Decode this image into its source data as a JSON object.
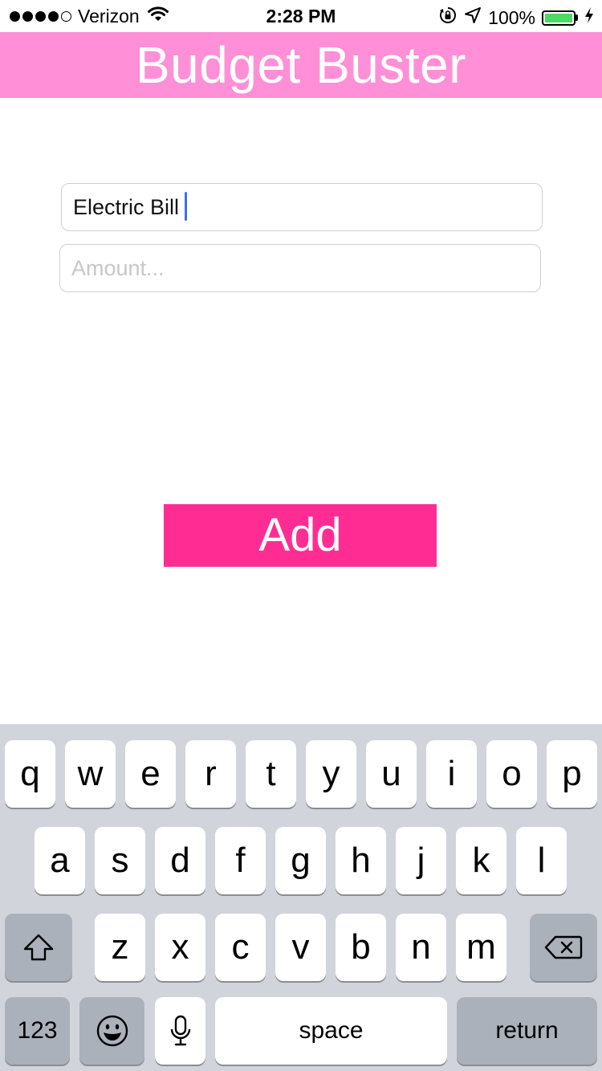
{
  "status_bar": {
    "carrier": "Verizon",
    "time": "2:28 PM",
    "battery": "100%",
    "battery_level": 1.0
  },
  "header": {
    "title": "Budget Buster"
  },
  "form": {
    "name_value": "Electric Bill",
    "name_placeholder": "",
    "amount_value": "",
    "amount_placeholder": "Amount...",
    "add_label": "Add"
  },
  "keyboard": {
    "row1": [
      "q",
      "w",
      "e",
      "r",
      "t",
      "y",
      "u",
      "i",
      "o",
      "p"
    ],
    "row2": [
      "a",
      "s",
      "d",
      "f",
      "g",
      "h",
      "j",
      "k",
      "l"
    ],
    "row3": [
      "z",
      "x",
      "c",
      "v",
      "b",
      "n",
      "m"
    ],
    "numbers_label": "123",
    "space_label": "space",
    "return_label": "return"
  },
  "colors": {
    "header": "#ff8fd6",
    "button": "#ff2d93",
    "caret": "#3b6ff2",
    "battery": "#4cd964"
  },
  "icons": [
    "wifi-icon",
    "orientation-lock-icon",
    "location-arrow-icon",
    "battery-icon",
    "charging-bolt-icon",
    "shift-icon",
    "delete-icon",
    "emoji-icon",
    "microphone-icon"
  ]
}
